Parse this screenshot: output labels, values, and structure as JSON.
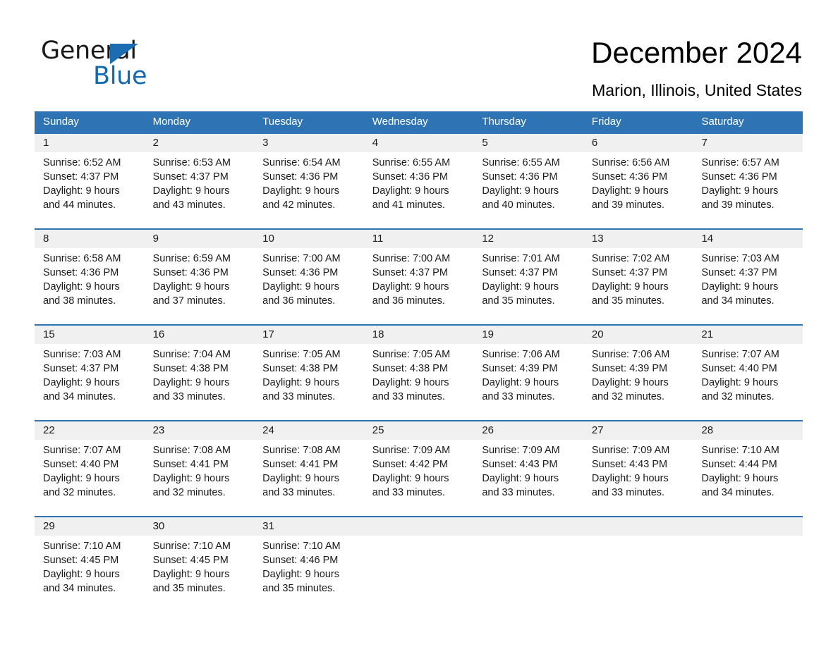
{
  "brand": {
    "name_part1": "General",
    "name_part2": "Blue",
    "accent_color": "#1269b0",
    "triangle_color": "#1b6cb3"
  },
  "header": {
    "month_title": "December 2024",
    "location": "Marion, Illinois, United States"
  },
  "theme": {
    "header_band": "#2e74b5",
    "date_band": "#f0f0f0",
    "rule_color": "#2e74b5",
    "text_color": "#1a1a1a"
  },
  "weekdays": [
    "Sunday",
    "Monday",
    "Tuesday",
    "Wednesday",
    "Thursday",
    "Friday",
    "Saturday"
  ],
  "weeks": [
    {
      "dates": [
        "1",
        "2",
        "3",
        "4",
        "5",
        "6",
        "7"
      ],
      "cells": [
        {
          "sunrise": "Sunrise: 6:52 AM",
          "sunset": "Sunset: 4:37 PM",
          "daylight_1": "Daylight: 9 hours",
          "daylight_2": "and 44 minutes."
        },
        {
          "sunrise": "Sunrise: 6:53 AM",
          "sunset": "Sunset: 4:37 PM",
          "daylight_1": "Daylight: 9 hours",
          "daylight_2": "and 43 minutes."
        },
        {
          "sunrise": "Sunrise: 6:54 AM",
          "sunset": "Sunset: 4:36 PM",
          "daylight_1": "Daylight: 9 hours",
          "daylight_2": "and 42 minutes."
        },
        {
          "sunrise": "Sunrise: 6:55 AM",
          "sunset": "Sunset: 4:36 PM",
          "daylight_1": "Daylight: 9 hours",
          "daylight_2": "and 41 minutes."
        },
        {
          "sunrise": "Sunrise: 6:55 AM",
          "sunset": "Sunset: 4:36 PM",
          "daylight_1": "Daylight: 9 hours",
          "daylight_2": "and 40 minutes."
        },
        {
          "sunrise": "Sunrise: 6:56 AM",
          "sunset": "Sunset: 4:36 PM",
          "daylight_1": "Daylight: 9 hours",
          "daylight_2": "and 39 minutes."
        },
        {
          "sunrise": "Sunrise: 6:57 AM",
          "sunset": "Sunset: 4:36 PM",
          "daylight_1": "Daylight: 9 hours",
          "daylight_2": "and 39 minutes."
        }
      ]
    },
    {
      "dates": [
        "8",
        "9",
        "10",
        "11",
        "12",
        "13",
        "14"
      ],
      "cells": [
        {
          "sunrise": "Sunrise: 6:58 AM",
          "sunset": "Sunset: 4:36 PM",
          "daylight_1": "Daylight: 9 hours",
          "daylight_2": "and 38 minutes."
        },
        {
          "sunrise": "Sunrise: 6:59 AM",
          "sunset": "Sunset: 4:36 PM",
          "daylight_1": "Daylight: 9 hours",
          "daylight_2": "and 37 minutes."
        },
        {
          "sunrise": "Sunrise: 7:00 AM",
          "sunset": "Sunset: 4:36 PM",
          "daylight_1": "Daylight: 9 hours",
          "daylight_2": "and 36 minutes."
        },
        {
          "sunrise": "Sunrise: 7:00 AM",
          "sunset": "Sunset: 4:37 PM",
          "daylight_1": "Daylight: 9 hours",
          "daylight_2": "and 36 minutes."
        },
        {
          "sunrise": "Sunrise: 7:01 AM",
          "sunset": "Sunset: 4:37 PM",
          "daylight_1": "Daylight: 9 hours",
          "daylight_2": "and 35 minutes."
        },
        {
          "sunrise": "Sunrise: 7:02 AM",
          "sunset": "Sunset: 4:37 PM",
          "daylight_1": "Daylight: 9 hours",
          "daylight_2": "and 35 minutes."
        },
        {
          "sunrise": "Sunrise: 7:03 AM",
          "sunset": "Sunset: 4:37 PM",
          "daylight_1": "Daylight: 9 hours",
          "daylight_2": "and 34 minutes."
        }
      ]
    },
    {
      "dates": [
        "15",
        "16",
        "17",
        "18",
        "19",
        "20",
        "21"
      ],
      "cells": [
        {
          "sunrise": "Sunrise: 7:03 AM",
          "sunset": "Sunset: 4:37 PM",
          "daylight_1": "Daylight: 9 hours",
          "daylight_2": "and 34 minutes."
        },
        {
          "sunrise": "Sunrise: 7:04 AM",
          "sunset": "Sunset: 4:38 PM",
          "daylight_1": "Daylight: 9 hours",
          "daylight_2": "and 33 minutes."
        },
        {
          "sunrise": "Sunrise: 7:05 AM",
          "sunset": "Sunset: 4:38 PM",
          "daylight_1": "Daylight: 9 hours",
          "daylight_2": "and 33 minutes."
        },
        {
          "sunrise": "Sunrise: 7:05 AM",
          "sunset": "Sunset: 4:38 PM",
          "daylight_1": "Daylight: 9 hours",
          "daylight_2": "and 33 minutes."
        },
        {
          "sunrise": "Sunrise: 7:06 AM",
          "sunset": "Sunset: 4:39 PM",
          "daylight_1": "Daylight: 9 hours",
          "daylight_2": "and 33 minutes."
        },
        {
          "sunrise": "Sunrise: 7:06 AM",
          "sunset": "Sunset: 4:39 PM",
          "daylight_1": "Daylight: 9 hours",
          "daylight_2": "and 32 minutes."
        },
        {
          "sunrise": "Sunrise: 7:07 AM",
          "sunset": "Sunset: 4:40 PM",
          "daylight_1": "Daylight: 9 hours",
          "daylight_2": "and 32 minutes."
        }
      ]
    },
    {
      "dates": [
        "22",
        "23",
        "24",
        "25",
        "26",
        "27",
        "28"
      ],
      "cells": [
        {
          "sunrise": "Sunrise: 7:07 AM",
          "sunset": "Sunset: 4:40 PM",
          "daylight_1": "Daylight: 9 hours",
          "daylight_2": "and 32 minutes."
        },
        {
          "sunrise": "Sunrise: 7:08 AM",
          "sunset": "Sunset: 4:41 PM",
          "daylight_1": "Daylight: 9 hours",
          "daylight_2": "and 32 minutes."
        },
        {
          "sunrise": "Sunrise: 7:08 AM",
          "sunset": "Sunset: 4:41 PM",
          "daylight_1": "Daylight: 9 hours",
          "daylight_2": "and 33 minutes."
        },
        {
          "sunrise": "Sunrise: 7:09 AM",
          "sunset": "Sunset: 4:42 PM",
          "daylight_1": "Daylight: 9 hours",
          "daylight_2": "and 33 minutes."
        },
        {
          "sunrise": "Sunrise: 7:09 AM",
          "sunset": "Sunset: 4:43 PM",
          "daylight_1": "Daylight: 9 hours",
          "daylight_2": "and 33 minutes."
        },
        {
          "sunrise": "Sunrise: 7:09 AM",
          "sunset": "Sunset: 4:43 PM",
          "daylight_1": "Daylight: 9 hours",
          "daylight_2": "and 33 minutes."
        },
        {
          "sunrise": "Sunrise: 7:10 AM",
          "sunset": "Sunset: 4:44 PM",
          "daylight_1": "Daylight: 9 hours",
          "daylight_2": "and 34 minutes."
        }
      ]
    },
    {
      "dates": [
        "29",
        "30",
        "31",
        "",
        "",
        "",
        ""
      ],
      "cells": [
        {
          "sunrise": "Sunrise: 7:10 AM",
          "sunset": "Sunset: 4:45 PM",
          "daylight_1": "Daylight: 9 hours",
          "daylight_2": "and 34 minutes."
        },
        {
          "sunrise": "Sunrise: 7:10 AM",
          "sunset": "Sunset: 4:45 PM",
          "daylight_1": "Daylight: 9 hours",
          "daylight_2": "and 35 minutes."
        },
        {
          "sunrise": "Sunrise: 7:10 AM",
          "sunset": "Sunset: 4:46 PM",
          "daylight_1": "Daylight: 9 hours",
          "daylight_2": "and 35 minutes."
        },
        {
          "sunrise": "",
          "sunset": "",
          "daylight_1": "",
          "daylight_2": ""
        },
        {
          "sunrise": "",
          "sunset": "",
          "daylight_1": "",
          "daylight_2": ""
        },
        {
          "sunrise": "",
          "sunset": "",
          "daylight_1": "",
          "daylight_2": ""
        },
        {
          "sunrise": "",
          "sunset": "",
          "daylight_1": "",
          "daylight_2": ""
        }
      ]
    }
  ]
}
